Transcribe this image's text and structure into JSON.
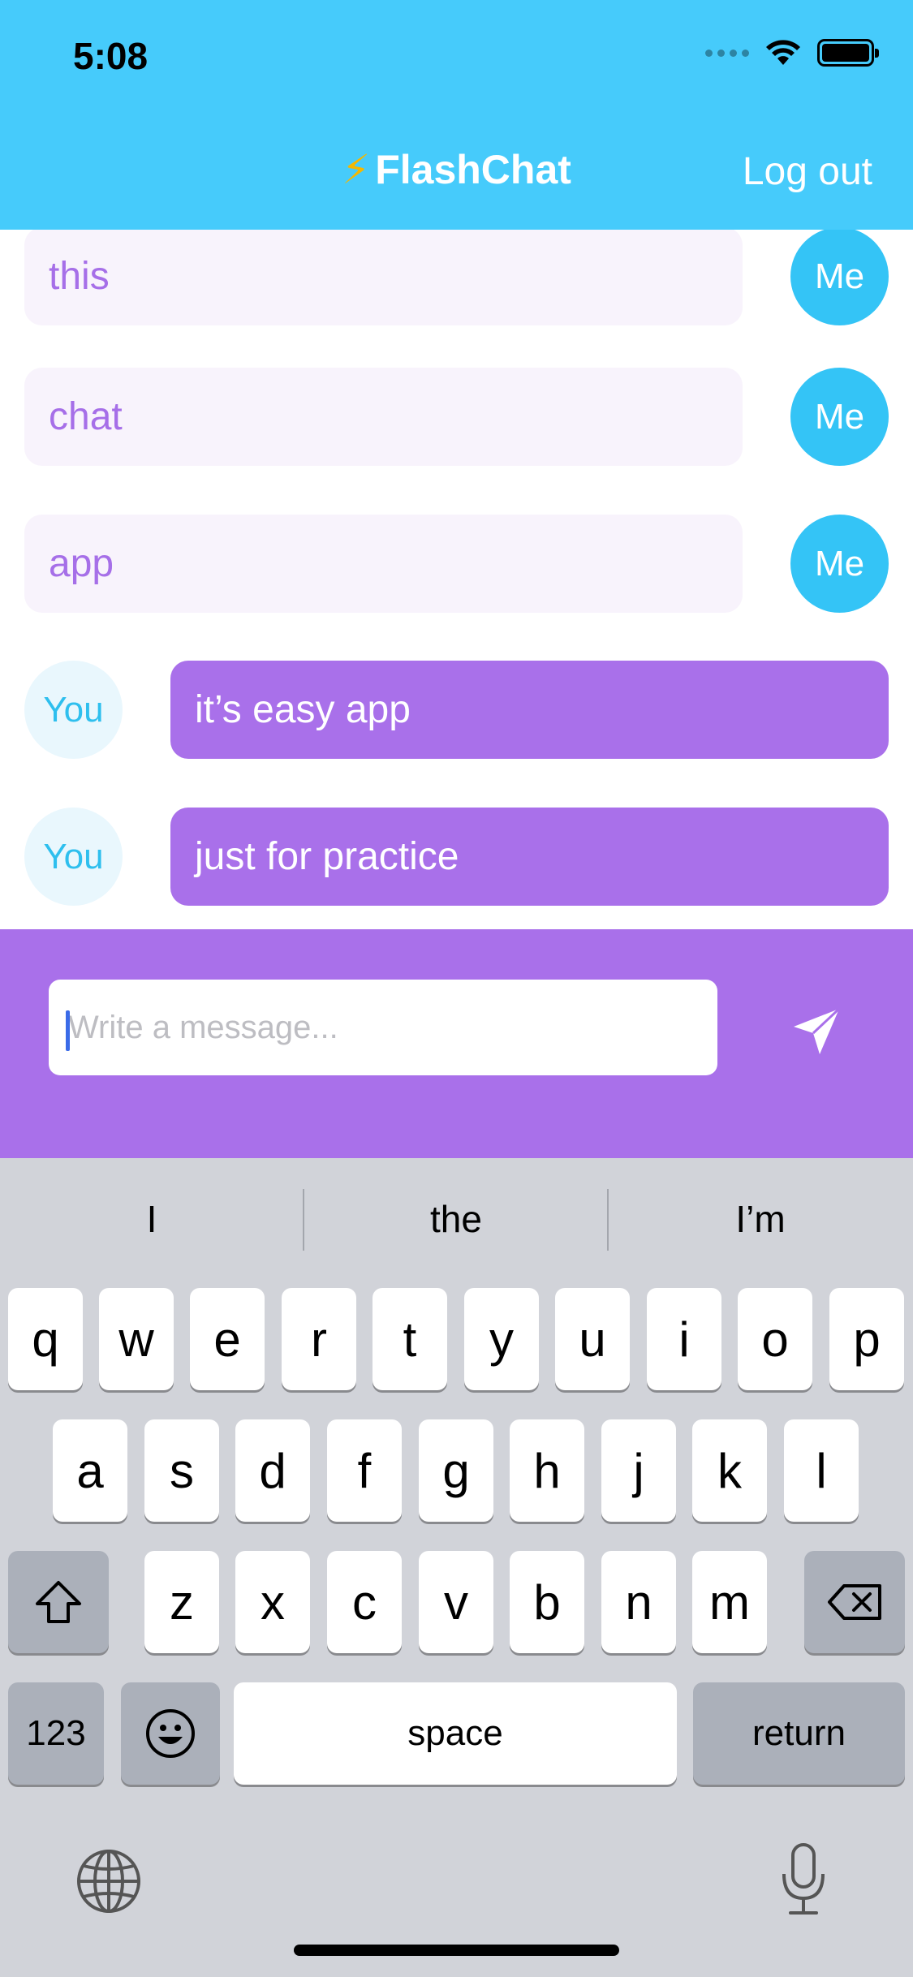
{
  "status_bar": {
    "time": "5:08"
  },
  "nav": {
    "title_icon": "⚡",
    "title": "FlashChat",
    "logout_label": "Log out"
  },
  "messages": [
    {
      "sender": "Me",
      "text": "this"
    },
    {
      "sender": "Me",
      "text": "chat"
    },
    {
      "sender": "Me",
      "text": "app"
    },
    {
      "sender": "You",
      "text": "it’s easy app"
    },
    {
      "sender": "You",
      "text": "just for practice"
    }
  ],
  "composer": {
    "placeholder": "Write a message...",
    "value": ""
  },
  "keyboard": {
    "suggestions": [
      "I",
      "the",
      "I’m"
    ],
    "row1": [
      "q",
      "w",
      "e",
      "r",
      "t",
      "y",
      "u",
      "i",
      "o",
      "p"
    ],
    "row2": [
      "a",
      "s",
      "d",
      "f",
      "g",
      "h",
      "j",
      "k",
      "l"
    ],
    "row3": [
      "z",
      "x",
      "c",
      "v",
      "b",
      "n",
      "m"
    ],
    "numbers_label": "123",
    "space_label": "space",
    "return_label": "return"
  },
  "colors": {
    "header": "#46CBFB",
    "accent_purple": "#A970EA",
    "avatar_me": "#34C4F6",
    "bubble_me_bg": "#F8F3FC"
  }
}
